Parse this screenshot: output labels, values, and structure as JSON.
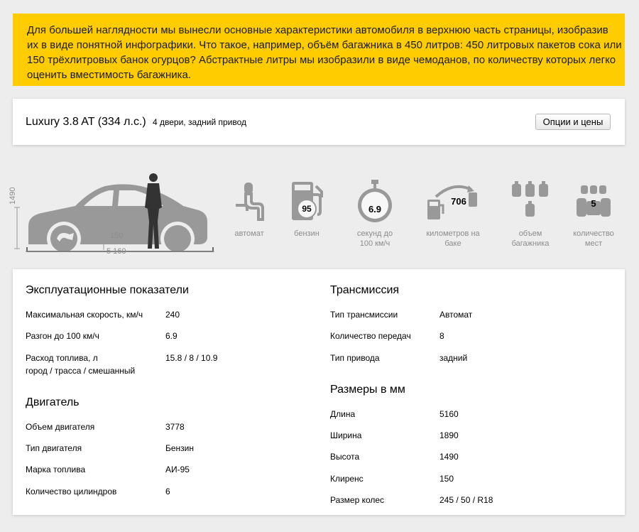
{
  "banner": {
    "lines": [
      "Для большей наглядности мы вынесли основные характеристики автомобиля в верхнюю часть страницы, изобразив",
      "их в виде понятной инфографики. Что такое, например, объём багажника в 450 литров: 450 литровых пакетов сока или",
      "150 трёхлитровых банок огурцов? Абстрактные литры мы изобразили в виде чемоданов, по количеству которых легко",
      "оценить вместимость багажника."
    ]
  },
  "model": {
    "name": "Luxury 3.8 AT (334 л.с.)",
    "subtitle": "4 двери, задний привод",
    "options_button": "Опции и цены"
  },
  "dimensions": {
    "height": "1490",
    "clearance": "150",
    "length": "5 160"
  },
  "features": [
    {
      "icon": "gear-shifter-icon",
      "value": "",
      "caption": [
        "автомат"
      ]
    },
    {
      "icon": "fuel-pump-icon",
      "value": "95",
      "caption": [
        "бензин"
      ]
    },
    {
      "icon": "stopwatch-icon",
      "value": "6.9",
      "caption": [
        "секунд до",
        "100 км/ч"
      ]
    },
    {
      "icon": "range-icon",
      "value": "706",
      "caption": [
        "километров на",
        "баке"
      ]
    },
    {
      "icon": "luggage-icon",
      "value": "",
      "caption": [
        "объем",
        "багажника"
      ]
    },
    {
      "icon": "seats-icon",
      "value": "5",
      "caption": [
        "количество",
        "мест"
      ]
    }
  ],
  "specs": {
    "performance": {
      "title": "Эксплуатационные показатели",
      "rows": [
        {
          "k": [
            "Максимальная скорость, км/ч"
          ],
          "v": "240"
        },
        {
          "k": [
            "Разгон до 100 км/ч"
          ],
          "v": "6.9"
        },
        {
          "k": [
            "Расход топлива, л",
            "город / трасса / смешанный"
          ],
          "v": "15.8 / 8 / 10.9"
        }
      ]
    },
    "engine": {
      "title": "Двигатель",
      "rows": [
        {
          "k": [
            "Объем двигателя"
          ],
          "v": "3778"
        },
        {
          "k": [
            "Тип двигателя"
          ],
          "v": "Бензин"
        },
        {
          "k": [
            "Марка топлива"
          ],
          "v": "АИ-95"
        },
        {
          "k": [
            "Количество цилиндров"
          ],
          "v": "6"
        }
      ]
    },
    "transmission": {
      "title": "Трансмиссия",
      "rows": [
        {
          "k": [
            "Тип трансмиссии"
          ],
          "v": "Автомат"
        },
        {
          "k": [
            "Количество передач"
          ],
          "v": "8"
        },
        {
          "k": [
            "Тип привода"
          ],
          "v": "задний"
        }
      ]
    },
    "dimensions": {
      "title": "Размеры в мм",
      "rows": [
        {
          "k": [
            "Длина"
          ],
          "v": "5160"
        },
        {
          "k": [
            "Ширина"
          ],
          "v": "1890"
        },
        {
          "k": [
            "Высота"
          ],
          "v": "1490"
        },
        {
          "k": [
            "Клиренс"
          ],
          "v": "150"
        },
        {
          "k": [
            "Размер колес"
          ],
          "v": "245 / 50 / R18"
        }
      ]
    }
  },
  "colors": {
    "accent": "#ffcc00",
    "icon_gray": "#999999",
    "caption_gray": "#8c8c8c"
  }
}
